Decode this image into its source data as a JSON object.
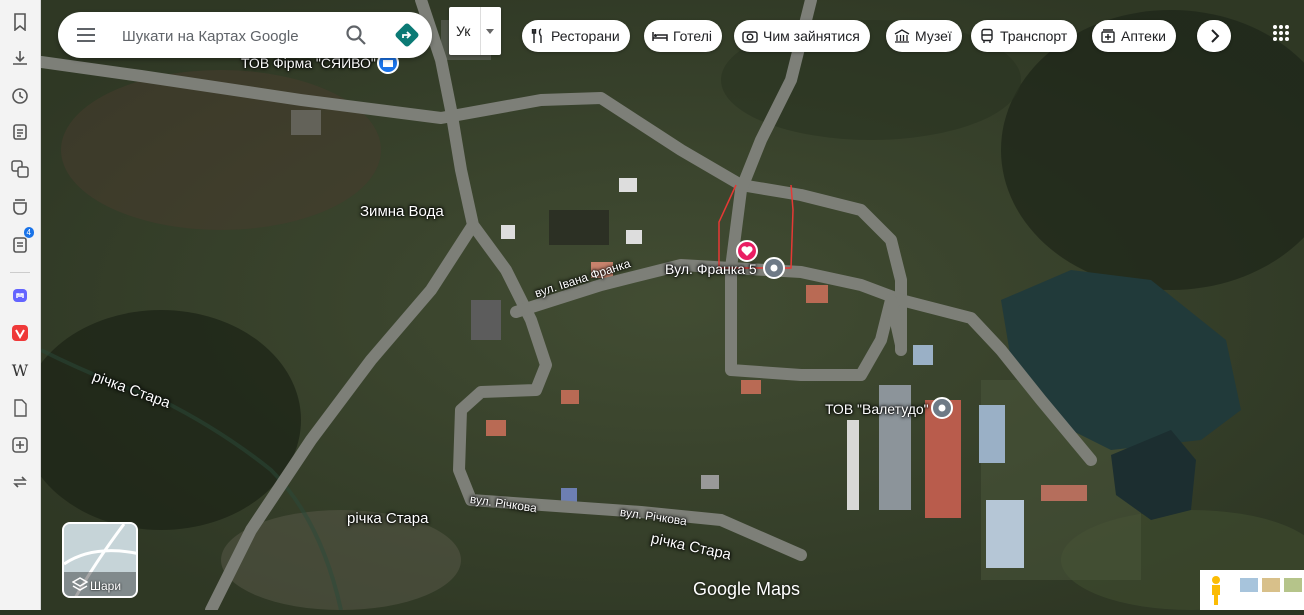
{
  "search": {
    "placeholder": "Шукати на Картах Google"
  },
  "lang": {
    "label": "Ук"
  },
  "chips": [
    {
      "label": "Ресторани",
      "icon": "fork-knife-icon"
    },
    {
      "label": "Готелі",
      "icon": "bed-icon"
    },
    {
      "label": "Чим зайнятися",
      "icon": "camera-icon"
    },
    {
      "label": "Музеї",
      "icon": "museum-icon"
    },
    {
      "label": "Транспорт",
      "icon": "bus-icon"
    },
    {
      "label": "Аптеки",
      "icon": "pharmacy-icon"
    }
  ],
  "sidebar": {
    "badge": "4"
  },
  "map": {
    "places": {
      "firm_syaivo": "ТОВ Фірма \"СЯЙВО\"",
      "franka5": "Вул. Франка 5",
      "valetudo": "ТОВ \"Валетудо\""
    },
    "labels": {
      "village": "Зимна Вода",
      "street_franka": "вул. Івана Франка",
      "street_richkova_1": "вул. Річкова",
      "street_richkova_2": "вул. Річкова",
      "river_1": "річка Стара",
      "river_2": "річка Стара",
      "river_3": "річка Стара"
    },
    "layers_label": "Шари",
    "logo": "Google Maps"
  }
}
